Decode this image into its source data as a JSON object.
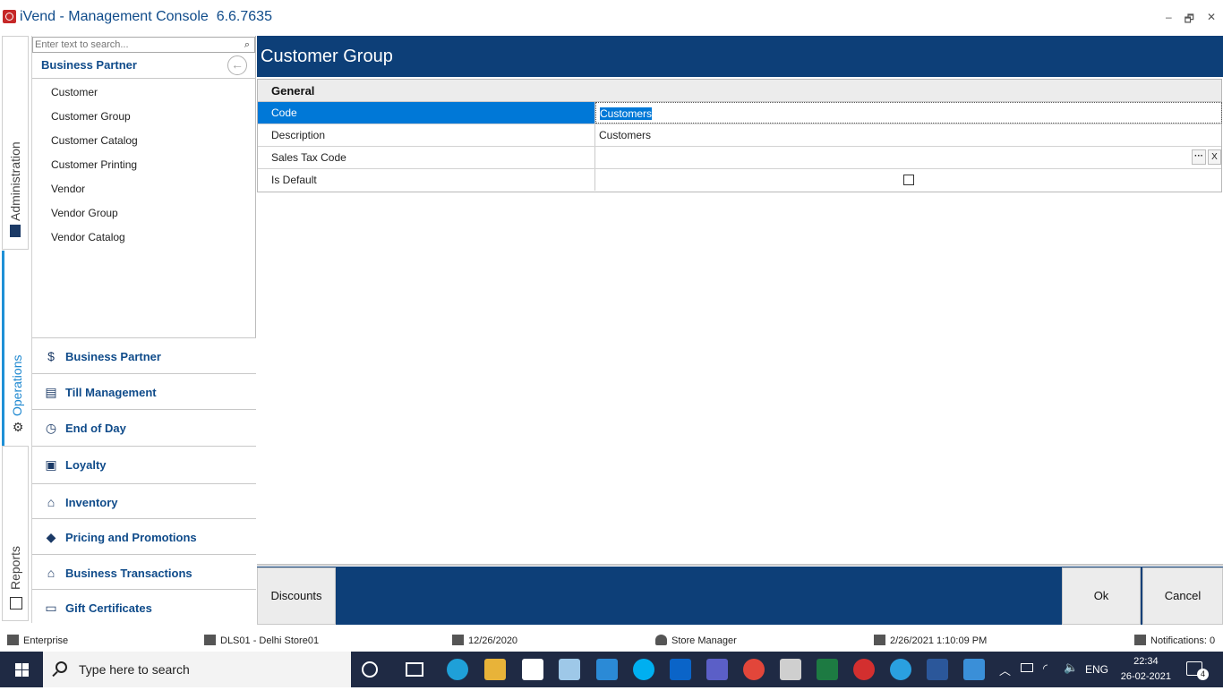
{
  "window": {
    "title": "iVend - Management Console",
    "version": "6.6.7635",
    "controls": [
      "–",
      "🗗",
      "✕"
    ]
  },
  "vtabs": [
    {
      "label": "Administration",
      "icon": "admin-icon"
    },
    {
      "label": "Operations",
      "icon": "gear-icon",
      "active": true
    },
    {
      "label": "Reports",
      "icon": "reports-icon"
    }
  ],
  "nav": {
    "search_placeholder": "Enter text to search...",
    "header": "Business Partner",
    "items": [
      "Customer",
      "Customer Group",
      "Customer Catalog",
      "Customer Printing",
      "Vendor",
      "Vendor Group",
      "Vendor Catalog"
    ],
    "groups": [
      {
        "label": "Business Partner",
        "icon": "business-partner-icon"
      },
      {
        "label": "Till Management",
        "icon": "till-icon"
      },
      {
        "label": "End of Day",
        "icon": "clock-icon"
      },
      {
        "label": "Loyalty",
        "icon": "gift-icon"
      },
      {
        "label": "Inventory",
        "icon": "warehouse-icon"
      },
      {
        "label": "Pricing and Promotions",
        "icon": "tag-icon"
      },
      {
        "label": "Business Transactions",
        "icon": "transactions-icon"
      },
      {
        "label": "Gift Certificates",
        "icon": "certificate-icon"
      }
    ]
  },
  "main": {
    "title": "Customer Group",
    "category": "General",
    "rows": [
      {
        "name": "Code",
        "value": "Customers"
      },
      {
        "name": "Description",
        "value": "Customers"
      },
      {
        "name": "Sales Tax Code",
        "value": ""
      },
      {
        "name": "Is Default",
        "value": ""
      }
    ],
    "buttons": {
      "ellipsis": "···",
      "clear": "X"
    }
  },
  "actions": {
    "discounts": "Discounts",
    "ok": "Ok",
    "cancel": "Cancel"
  },
  "status": {
    "edition": "Enterprise",
    "store": "DLS01 - Delhi Store01",
    "business_date": "12/26/2020",
    "role": "Store Manager",
    "login_time": "2/26/2021 1:10:09 PM",
    "notifications": "Notifications: 0"
  },
  "taskbar": {
    "search_text": "Type here to search",
    "lang": "ENG",
    "time": "22:34",
    "date": "26-02-2021",
    "notif_count": "4"
  }
}
